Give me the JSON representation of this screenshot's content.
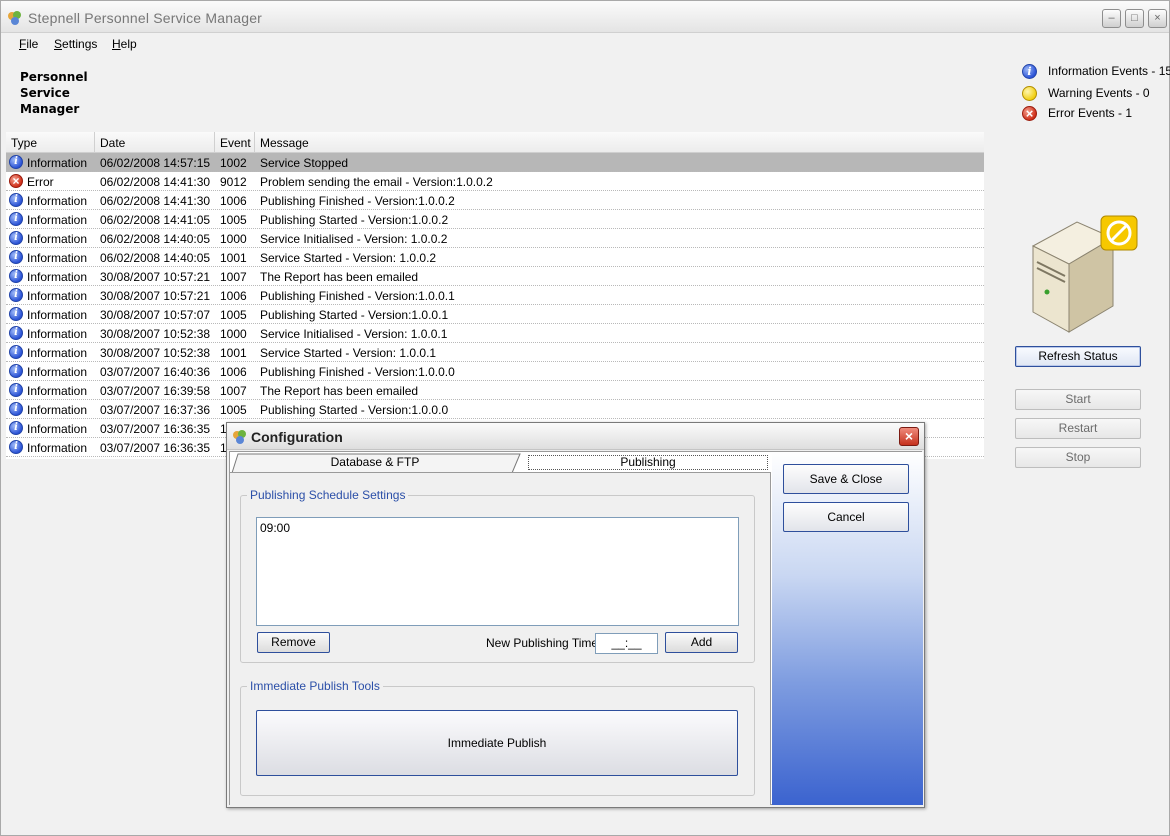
{
  "app": {
    "title": "Stepnell Personnel Service Manager",
    "heading_lines": [
      "Personnel",
      "Service",
      "Manager"
    ]
  },
  "window_controls": {
    "minimize": "–",
    "maximize": "□",
    "close": "×"
  },
  "menu": {
    "items": [
      "File",
      "Settings",
      "Help"
    ]
  },
  "summary": {
    "items": [
      {
        "icon": "info-icon",
        "label": "Information Events - 15"
      },
      {
        "icon": "warning-icon",
        "label": "Warning Events - 0"
      },
      {
        "icon": "error-icon",
        "label": "Error Events - 1"
      }
    ]
  },
  "grid": {
    "columns": [
      "Type",
      "Date",
      "Event",
      "Message"
    ],
    "rows": [
      {
        "type": "Information",
        "date": "06/02/2008 14:57:15",
        "event": "1002",
        "message": "Service Stopped",
        "selected": true
      },
      {
        "type": "Error",
        "date": "06/02/2008 14:41:30",
        "event": "9012",
        "message": "Problem sending the email - Version:1.0.0.2"
      },
      {
        "type": "Information",
        "date": "06/02/2008 14:41:30",
        "event": "1006",
        "message": "Publishing Finished - Version:1.0.0.2"
      },
      {
        "type": "Information",
        "date": "06/02/2008 14:41:05",
        "event": "1005",
        "message": "Publishing Started - Version:1.0.0.2"
      },
      {
        "type": "Information",
        "date": "06/02/2008 14:40:05",
        "event": "1000",
        "message": "Service Initialised - Version: 1.0.0.2"
      },
      {
        "type": "Information",
        "date": "06/02/2008 14:40:05",
        "event": "1001",
        "message": "Service Started - Version: 1.0.0.2"
      },
      {
        "type": "Information",
        "date": "30/08/2007 10:57:21",
        "event": "1007",
        "message": "The Report has been emailed"
      },
      {
        "type": "Information",
        "date": "30/08/2007 10:57:21",
        "event": "1006",
        "message": "Publishing Finished - Version:1.0.0.1"
      },
      {
        "type": "Information",
        "date": "30/08/2007 10:57:07",
        "event": "1005",
        "message": "Publishing Started - Version:1.0.0.1"
      },
      {
        "type": "Information",
        "date": "30/08/2007 10:52:38",
        "event": "1000",
        "message": "Service Initialised - Version: 1.0.0.1"
      },
      {
        "type": "Information",
        "date": "30/08/2007 10:52:38",
        "event": "1001",
        "message": "Service Started - Version: 1.0.0.1"
      },
      {
        "type": "Information",
        "date": "03/07/2007 16:40:36",
        "event": "1006",
        "message": "Publishing Finished - Version:1.0.0.0"
      },
      {
        "type": "Information",
        "date": "03/07/2007 16:39:58",
        "event": "1007",
        "message": "The Report has been emailed"
      },
      {
        "type": "Information",
        "date": "03/07/2007 16:37:36",
        "event": "1005",
        "message": "Publishing Started - Version:1.0.0.0"
      },
      {
        "type": "Information",
        "date": "03/07/2007 16:36:35",
        "event": "1",
        "message": ""
      },
      {
        "type": "Information",
        "date": "03/07/2007 16:36:35",
        "event": "1",
        "message": ""
      }
    ]
  },
  "controls": {
    "refresh": "Refresh Status",
    "start": "Start",
    "restart": "Restart",
    "stop": "Stop"
  },
  "dialog": {
    "title": "Configuration",
    "tabs": [
      "Database & FTP",
      "Publishing"
    ],
    "active_tab": "Publishing",
    "schedule": {
      "legend": "Publishing Schedule Settings",
      "times": [
        "09:00"
      ],
      "remove": "Remove",
      "new_time_label": "New Publishing Time",
      "new_time_value": "__:__",
      "add": "Add"
    },
    "immediate": {
      "legend": "Immediate Publish Tools",
      "button": "Immediate Publish"
    },
    "save_close": "Save & Close",
    "cancel": "Cancel"
  },
  "colors": {
    "legend_text": "#2b4fa8",
    "selected_row": "#b7b7b7",
    "button_border": "#2e4f9c",
    "panel_gradient_bottom": "#3b63cf"
  }
}
